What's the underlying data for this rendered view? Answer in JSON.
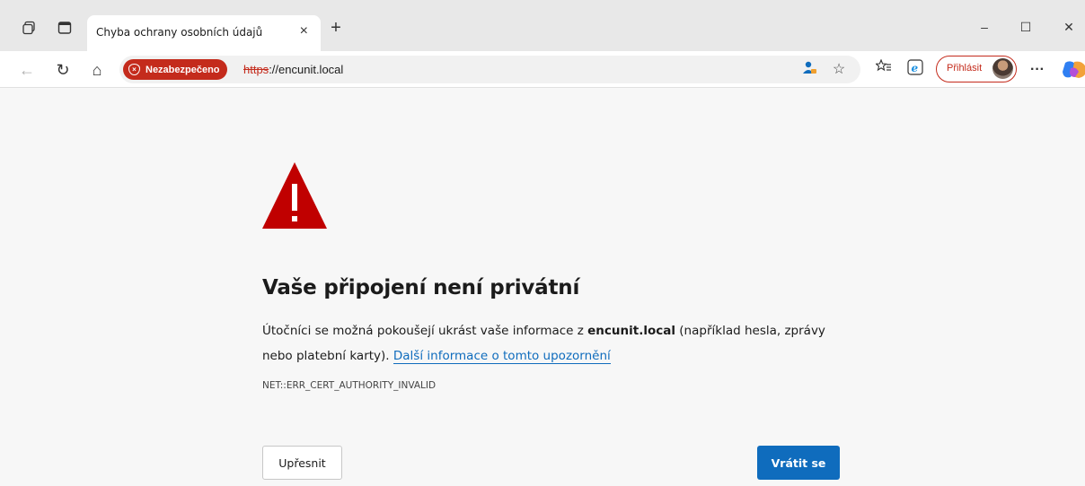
{
  "tab": {
    "title": "Chyba ochrany osobních údajů",
    "close": "×",
    "new_tab": "+"
  },
  "window_controls": {
    "minimize": "–",
    "maximize": "☐",
    "close": "✕"
  },
  "toolbar": {
    "back": "←",
    "reload": "↻",
    "home": "⌂",
    "security_badge": "Nezabezpečeno",
    "url_scheme": "https",
    "url_rest": "://encunit.local",
    "sign_in": "Přihlásit",
    "more": "···"
  },
  "page": {
    "heading": "Vaše připojení není privátní",
    "desc_part1": "Útočníci se možná pokoušejí ukrást vaše informace z ",
    "desc_host": "encunit.local",
    "desc_part2": " (například hesla, zprávy nebo platební karty). ",
    "learn_more": "Další informace o tomto upozornění",
    "error_code": "NET::ERR_CERT_AUTHORITY_INVALID",
    "advanced_button": "Upřesnit",
    "back_button": "Vrátit se"
  },
  "colors": {
    "danger": "#c42b1c",
    "accent": "#0f6cbd",
    "warning_icon": "#c00000"
  }
}
